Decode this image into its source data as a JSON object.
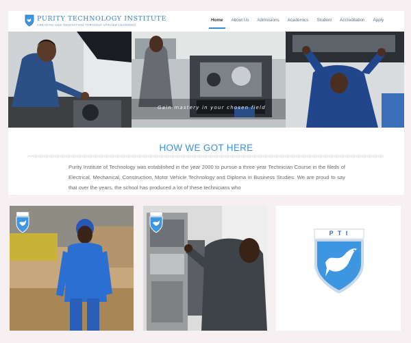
{
  "brand": {
    "title": "PURITY TECHNOLOGY INSTITUTE",
    "tagline": "CREATIVE AND INNOVATION THROUGH APPLIED LEARNING"
  },
  "nav": {
    "items": [
      {
        "label": "Home",
        "active": true
      },
      {
        "label": "About Us",
        "active": false
      },
      {
        "label": "Admissions",
        "active": false
      },
      {
        "label": "Academics",
        "active": false
      },
      {
        "label": "Student",
        "active": false
      },
      {
        "label": "Accreditation",
        "active": false
      },
      {
        "label": "Apply",
        "active": false
      }
    ]
  },
  "hero": {
    "caption": "Gain mastery in your chosen field"
  },
  "section": {
    "title": "HOW WE GOT HERE",
    "body": "Purity Institute of Technology was established in the year 2000 to pursue a three year Technician Course in the fileds of Electrical, Mechanical, Construction, Motor Vehicle Technology and Diploma in Business Studies. We are proud to say that over the years, the school has produced a lot of these technicians who"
  },
  "logo": {
    "letters": "P T I"
  },
  "colors": {
    "accent": "#3b8fd6",
    "background": "#f6f0f2",
    "shield": "#3e95e0"
  }
}
